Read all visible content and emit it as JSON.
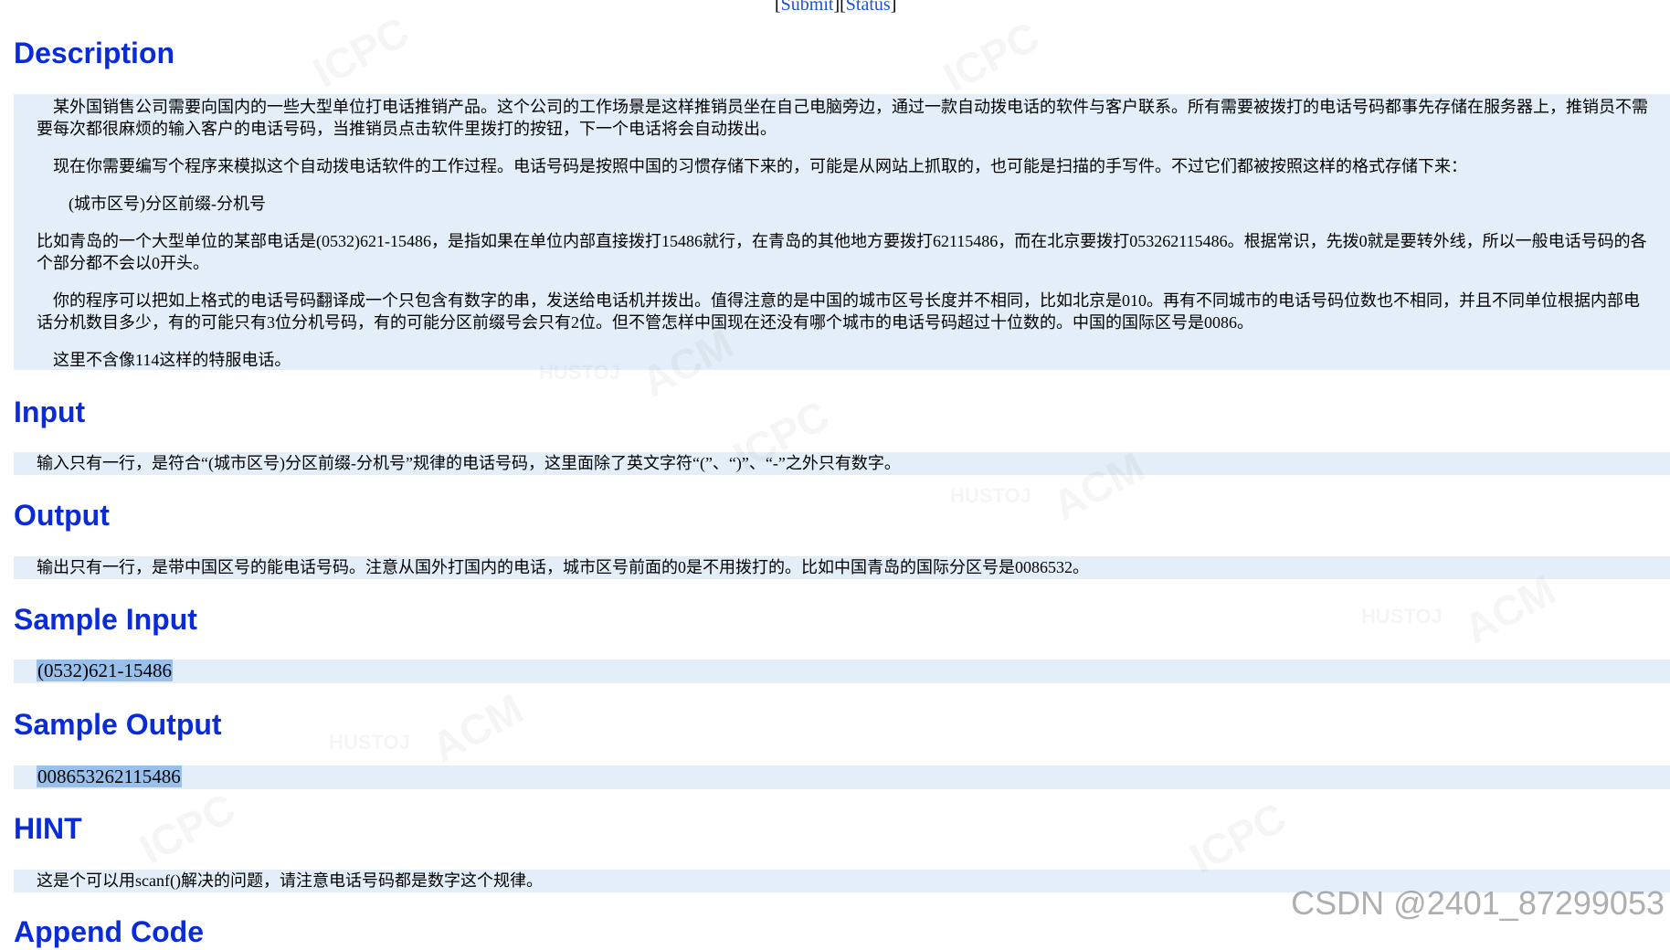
{
  "top_links": {
    "submit": "Submit",
    "status": "Status"
  },
  "sections": {
    "description": {
      "title": "Description",
      "paragraphs": [
        "某外国销售公司需要向国内的一些大型单位打电话推销产品。这个公司的工作场景是这样推销员坐在自己电脑旁边，通过一款自动拨电话的软件与客户联系。所有需要被拨打的电话号码都事先存储在服务器上，推销员不需要每次都很麻烦的输入客户的电话号码，当推销员点击软件里拨打的按钮，下一个电话将会自动拨出。",
        "现在你需要编写个程序来模拟这个自动拨电话软件的工作过程。电话号码是按照中国的习惯存储下来的，可能是从网站上抓取的，也可能是扫描的手写件。不过它们都被按照这样的格式存储下来：",
        "(城市区号)分区前缀-分机号",
        "比如青岛的一个大型单位的某部电话是(0532)621-15486，是指如果在单位内部直接拨打15486就行，在青岛的其他地方要拨打62115486，而在北京要拨打053262115486。根据常识，先拨0就是要转外线，所以一般电话号码的各个部分都不会以0开头。",
        "你的程序可以把如上格式的电话号码翻译成一个只包含有数字的串，发送给电话机并拨出。值得注意的是中国的城市区号长度并不相同，比如北京是010。再有不同城市的电话号码位数也不相同，并且不同单位根据内部电话分机数目多少，有的可能只有3位分机号码，有的可能分区前缀号会只有2位。但不管怎样中国现在还没有哪个城市的电话号码超过十位数的。中国的国际区号是0086。",
        "这里不含像114这样的特服电话。"
      ]
    },
    "input": {
      "title": "Input",
      "text": "输入只有一行，是符合“(城市区号)分区前缀-分机号”规律的电话号码，这里面除了英文字符“(”、“)”、“-”之外只有数字。"
    },
    "output": {
      "title": "Output",
      "text": "输出只有一行，是带中国区号的能电话号码。注意从国外打国内的电话，城市区号前面的0是不用拨打的。比如中国青岛的国际分区号是0086532。"
    },
    "sample_input": {
      "title": "Sample Input",
      "text": "(0532)621-15486"
    },
    "sample_output": {
      "title": "Sample Output",
      "text": "008653262115486"
    },
    "hint": {
      "title": "HINT",
      "text": "这是个可以用scanf()解决的问题，请注意电话号码都是数字这个规律。"
    },
    "append_code": {
      "title": "Append Code"
    }
  },
  "watermark": {
    "site": "CSDN @2401_87299053",
    "husto": "HUSTOJ",
    "acm": "ACM",
    "icpc": "ICPC"
  }
}
